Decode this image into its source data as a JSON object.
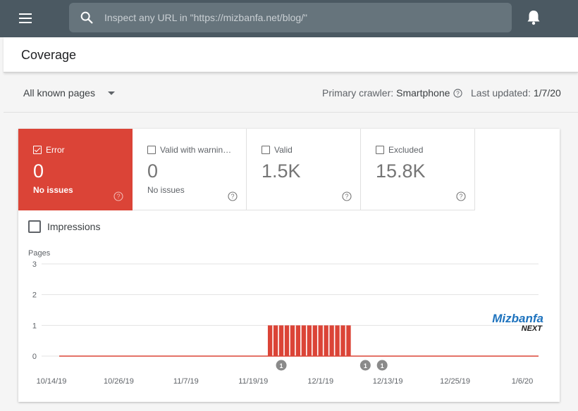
{
  "topbar": {
    "menu_icon": "hamburger-menu-icon",
    "search_icon": "search-icon",
    "search_placeholder": "Inspect any URL in \"https://mizbanfa.net/blog/\"",
    "bell_icon": "notifications-bell-icon"
  },
  "page": {
    "title": "Coverage"
  },
  "filter": {
    "selected": "All known pages",
    "crawler_label": "Primary crawler:",
    "crawler_value": "Smartphone",
    "updated_label": "Last updated:",
    "updated_value": "1/7/20"
  },
  "tiles": [
    {
      "label": "Error",
      "count": "0",
      "subtitle": "No issues",
      "checked": true,
      "color": "#db4437"
    },
    {
      "label": "Valid with warnin…",
      "count": "0",
      "subtitle": "No issues",
      "checked": false
    },
    {
      "label": "Valid",
      "count": "1.5K",
      "subtitle": "",
      "checked": false
    },
    {
      "label": "Excluded",
      "count": "15.8K",
      "subtitle": "",
      "checked": false
    }
  ],
  "impressions_label": "Impressions",
  "watermark": {
    "line1": "Mizbanfa",
    "line2": "NEXT"
  },
  "chart_data": {
    "type": "bar",
    "ylabel": "Pages",
    "ylim": [
      0,
      3
    ],
    "yticks": [
      "0",
      "1",
      "2",
      "3"
    ],
    "xticks": [
      "10/14/19",
      "10/26/19",
      "11/7/19",
      "11/19/19",
      "12/1/19",
      "12/13/19",
      "12/25/19",
      "1/6/20"
    ],
    "x_start": "10/14/19",
    "x_end": "1/6/20",
    "series": [
      {
        "color": "#db4437",
        "points": [
          {
            "x": "11/22/19",
            "y": 1
          },
          {
            "x": "11/23/19",
            "y": 1
          },
          {
            "x": "11/24/19",
            "y": 1
          },
          {
            "x": "11/25/19",
            "y": 1
          },
          {
            "x": "11/26/19",
            "y": 1
          },
          {
            "x": "11/27/19",
            "y": 1
          },
          {
            "x": "11/28/19",
            "y": 1
          },
          {
            "x": "11/29/19",
            "y": 1
          },
          {
            "x": "11/30/19",
            "y": 1
          },
          {
            "x": "12/1/19",
            "y": 1
          },
          {
            "x": "12/2/19",
            "y": 1
          },
          {
            "x": "12/3/19",
            "y": 1
          },
          {
            "x": "12/4/19",
            "y": 1
          },
          {
            "x": "12/5/19",
            "y": 1
          },
          {
            "x": "12/6/19",
            "y": 1
          }
        ],
        "baseline": 0
      }
    ],
    "annotations": [
      {
        "x": "11/24/19",
        "label": "1"
      },
      {
        "x": "12/9/19",
        "label": "1"
      },
      {
        "x": "12/12/19",
        "label": "1"
      }
    ],
    "grid": true
  }
}
